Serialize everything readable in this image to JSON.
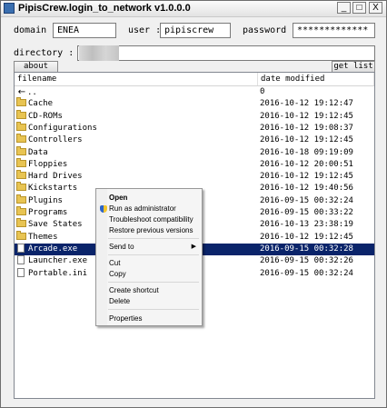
{
  "window": {
    "title": "PipisCrew.login_to_network v1.0.0.0"
  },
  "titlebar": {
    "minimize": "_",
    "maximize": "□",
    "close": "X"
  },
  "form": {
    "domain_label": "domain :",
    "domain_value": "ENEA",
    "user_label": "user :",
    "user_value": "pipiscrew",
    "password_label": "password :",
    "password_value": "*************",
    "directory_label": "directory :",
    "directory_value": ""
  },
  "buttons": {
    "about": "about",
    "get_list": "get list"
  },
  "list": {
    "columns": [
      "filename",
      "date modified"
    ],
    "rows": [
      {
        "icon": "back-arrow-icon",
        "name": "..",
        "date": "0"
      },
      {
        "icon": "folder-icon",
        "name": "Cache",
        "date": "2016-10-12 19:12:47"
      },
      {
        "icon": "folder-icon",
        "name": "CD-ROMs",
        "date": "2016-10-12 19:12:45"
      },
      {
        "icon": "folder-icon",
        "name": "Configurations",
        "date": "2016-10-12 19:08:37"
      },
      {
        "icon": "folder-icon",
        "name": "Controllers",
        "date": "2016-10-12 19:12:45"
      },
      {
        "icon": "folder-icon",
        "name": "Data",
        "date": "2016-10-18 09:19:09"
      },
      {
        "icon": "folder-icon",
        "name": "Floppies",
        "date": "2016-10-12 20:00:51"
      },
      {
        "icon": "folder-icon",
        "name": "Hard Drives",
        "date": "2016-10-12 19:12:45"
      },
      {
        "icon": "folder-icon",
        "name": "Kickstarts",
        "date": "2016-10-12 19:40:56"
      },
      {
        "icon": "folder-icon",
        "name": "Plugins",
        "date": "2016-09-15 00:32:24"
      },
      {
        "icon": "folder-icon",
        "name": "Programs",
        "date": "2016-09-15 00:33:22"
      },
      {
        "icon": "folder-icon",
        "name": "Save States",
        "date": "2016-10-13 23:38:19"
      },
      {
        "icon": "folder-icon",
        "name": "Themes",
        "date": "2016-10-12 19:12:45"
      },
      {
        "icon": "file-icon",
        "name": "Arcade.exe",
        "date": "2016-09-15 00:32:28",
        "selected": true
      },
      {
        "icon": "file-icon",
        "name": "Launcher.exe",
        "date": "2016-09-15 00:32:26"
      },
      {
        "icon": "file-icon",
        "name": "Portable.ini",
        "date": "2016-09-15 00:32:24"
      }
    ]
  },
  "context_menu": {
    "items": [
      {
        "label": "Open",
        "bold": true
      },
      {
        "label": "Run as administrator",
        "icon": "shield-icon"
      },
      {
        "label": "Troubleshoot compatibility"
      },
      {
        "label": "Restore previous versions"
      },
      {
        "label": "Send to",
        "submenu": true
      },
      {
        "label": "Cut"
      },
      {
        "label": "Copy"
      },
      {
        "label": "Create shortcut"
      },
      {
        "label": "Delete"
      },
      {
        "label": "Properties"
      }
    ]
  },
  "colors": {
    "selection": "#0a246a",
    "folder": "#e8c452"
  }
}
